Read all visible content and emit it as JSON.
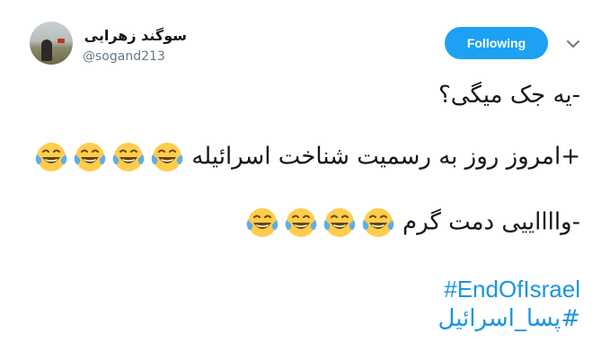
{
  "author": {
    "display_name": "سوگند زهرایی",
    "handle": "@sogand213"
  },
  "follow_button": {
    "label": "Following",
    "color": "#1da1f2"
  },
  "menu": {
    "icon": "chevron-down-icon"
  },
  "tweet": {
    "line1": "-یه جک میگی؟",
    "line2": "+امروز روز به رسمیت شناخت اسرائیله",
    "line3": "-وااااییی دمت گرم",
    "emoji": "face-with-tears-of-joy-icon",
    "hashtags": [
      "#EndOfIsrael",
      "#پسا_اسرائیل"
    ],
    "hashtag_color": "#1b95e0"
  }
}
